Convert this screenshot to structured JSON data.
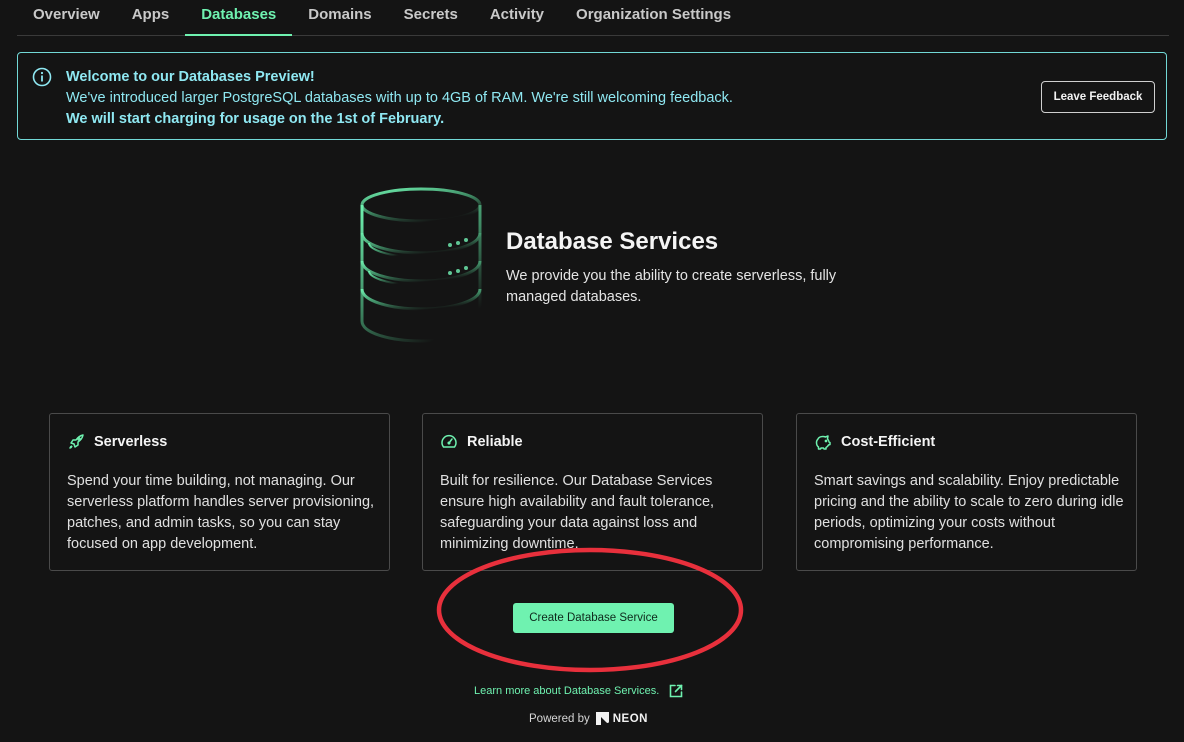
{
  "tabs": [
    {
      "label": "Overview",
      "active": false
    },
    {
      "label": "Apps",
      "active": false
    },
    {
      "label": "Databases",
      "active": true
    },
    {
      "label": "Domains",
      "active": false
    },
    {
      "label": "Secrets",
      "active": false
    },
    {
      "label": "Activity",
      "active": false
    },
    {
      "label": "Organization Settings",
      "active": false
    }
  ],
  "banner": {
    "icon": "info-icon",
    "title": "Welcome to our Databases Preview!",
    "line1": "We've introduced larger PostgreSQL databases with up to 4GB of RAM. We're still welcoming feedback.",
    "line2": "We will start charging for usage on the 1st of February.",
    "feedback_label": "Leave Feedback",
    "color": "#72d8d6"
  },
  "hero": {
    "icon": "database-icon",
    "title": "Database Services",
    "description": "We provide you the ability to create serverless, fully managed databases."
  },
  "cards": [
    {
      "icon": "rocket-icon",
      "title": "Serverless",
      "body": "Spend your time building, not managing. Our serverless platform handles server provisioning, patches, and admin tasks, so you can stay focused on app development."
    },
    {
      "icon": "gauge-icon",
      "title": "Reliable",
      "body": "Built for resilience. Our Database Services ensure high availability and fault tolerance, safeguarding your data against loss and minimizing downtime."
    },
    {
      "icon": "piggy-bank-icon",
      "title": "Cost-Efficient",
      "body": "Smart savings and scalability. Enjoy predictable pricing and the ability to scale to zero during idle periods, optimizing your costs without compromising performance."
    }
  ],
  "create_button": {
    "label": "Create Database Service",
    "color": "#6ff2b0"
  },
  "learn_more": {
    "label": "Learn more about Database Services.",
    "icon": "external-link-icon"
  },
  "footer": {
    "powered_by": "Powered by",
    "brand": "NEON",
    "brand_icon": "neon-logo-icon"
  },
  "annotation": {
    "color": "#e8303c"
  }
}
